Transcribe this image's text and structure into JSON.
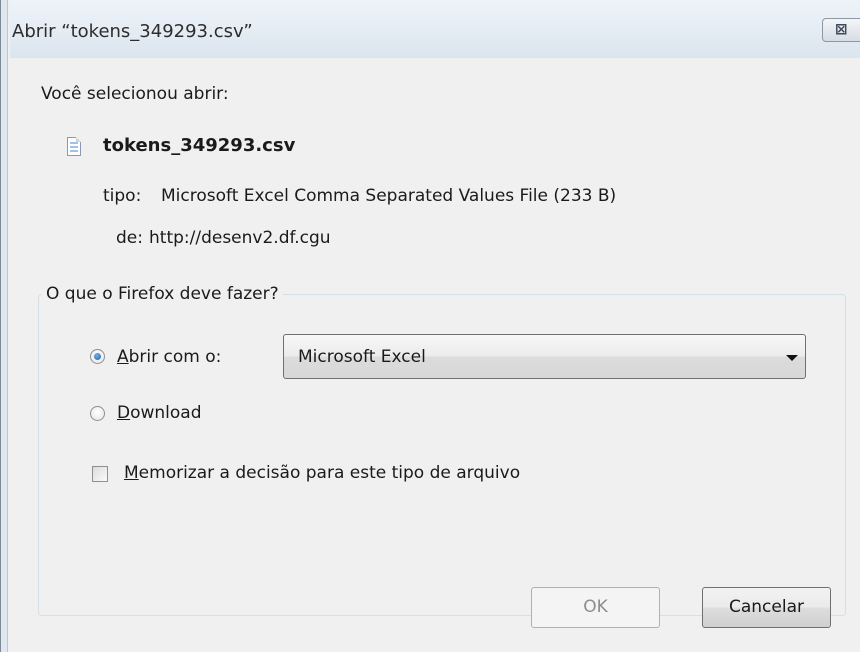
{
  "window": {
    "title": "Abrir “tokens_349293.csv”",
    "close_glyph": "⊠"
  },
  "dialog": {
    "intro": "Você selecionou abrir:",
    "file_icon": "document-icon",
    "filename": "tokens_349293.csv",
    "type_label": "tipo:",
    "type_value": "Microsoft Excel Comma Separated Values File (233 B)",
    "from_label": "de:",
    "from_value": "http://desenv2.df.cgu"
  },
  "action_group": {
    "legend": "O que o Firefox deve fazer?",
    "open_with": {
      "label_accel": "A",
      "label_rest": "brir com o:",
      "checked": true,
      "selected_app": "Microsoft Excel"
    },
    "download": {
      "label_accel": "D",
      "label_rest": "ownload",
      "checked": false
    },
    "remember": {
      "label_accel": "M",
      "label_rest": "emorizar a decisão para este tipo de arquivo",
      "checked": false
    }
  },
  "buttons": {
    "ok": "OK",
    "cancel": "Cancelar"
  },
  "colors": {
    "titlebar": "#e3ebf3",
    "dialog_bg": "#f0f0f0",
    "radio_accent": "#1b5fab"
  }
}
